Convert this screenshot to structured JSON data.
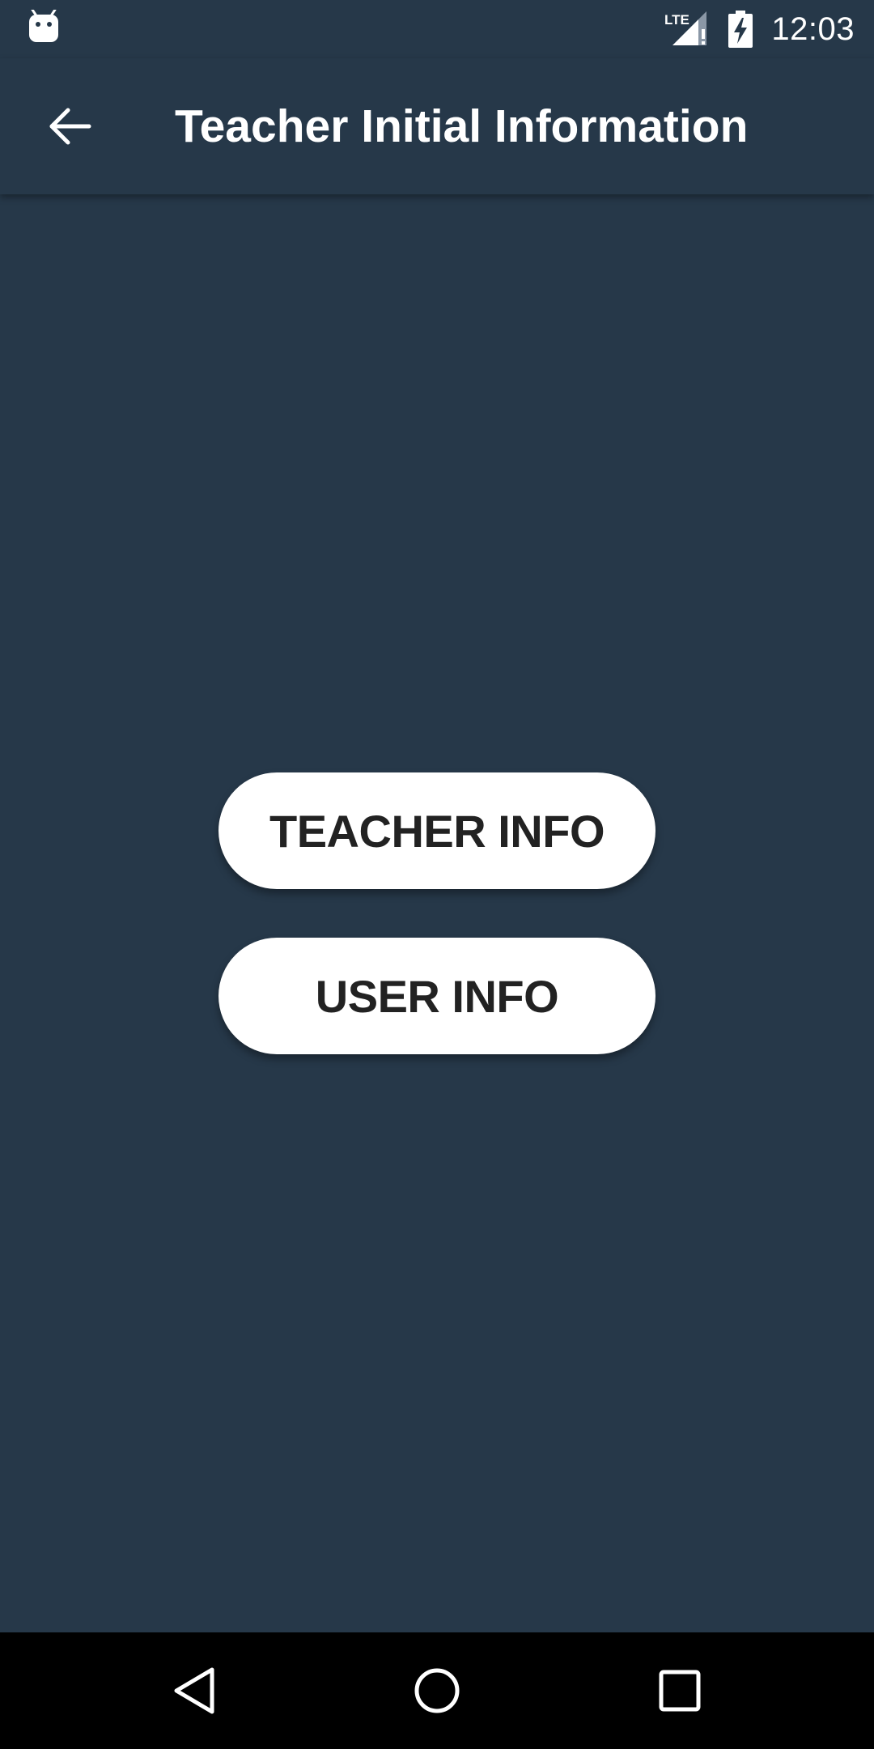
{
  "status_bar": {
    "notification_icon": "android-icon",
    "network_icon": "lte-signal-icon",
    "network_label": "LTE",
    "battery_icon": "battery-charging-icon",
    "time": "12:03"
  },
  "app_bar": {
    "back_icon": "arrow-back-icon",
    "title": "Teacher Initial Information"
  },
  "main": {
    "buttons": [
      {
        "label": "TEACHER INFO"
      },
      {
        "label": "USER INFO"
      }
    ]
  },
  "nav_bar": {
    "back_icon": "nav-back-triangle-icon",
    "home_icon": "nav-home-circle-icon",
    "recents_icon": "nav-recents-square-icon"
  },
  "colors": {
    "background": "#263849",
    "button_bg": "#ffffff",
    "button_text": "#222222",
    "text_light": "#ffffff",
    "nav_bar": "#000000"
  }
}
